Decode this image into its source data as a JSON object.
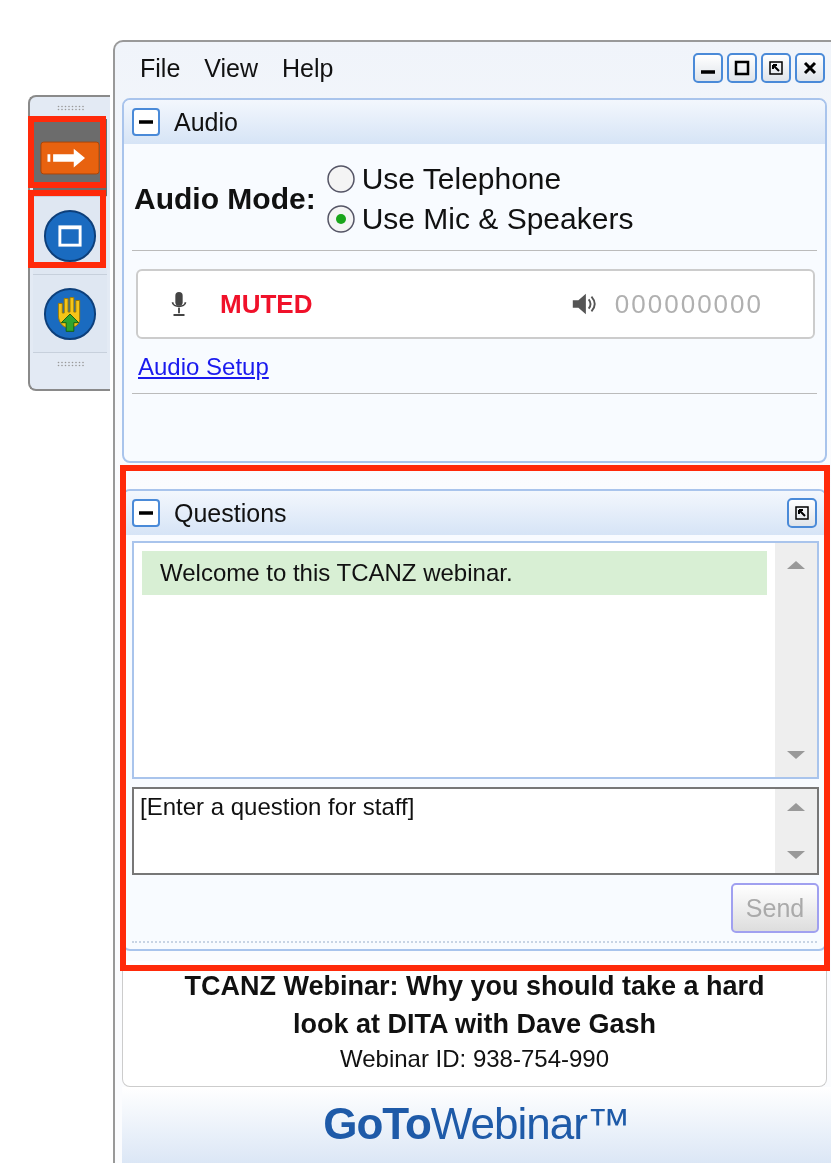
{
  "toolbar": [
    {
      "kind": "arrow",
      "selected": true
    },
    {
      "kind": "screen",
      "selected": false
    },
    {
      "kind": "hand",
      "selected": false
    }
  ],
  "menu": [
    "File",
    "View",
    "Help"
  ],
  "audio_panel": {
    "title": "Audio",
    "mode_label": "Audio Mode:",
    "options": [
      {
        "label": "Use Telephone",
        "selected": false
      },
      {
        "label": "Use Mic & Speakers",
        "selected": true
      }
    ],
    "mic_status": "MUTED",
    "speaker_reading": "000000000",
    "setup_link": "Audio Setup"
  },
  "questions_panel": {
    "title": "Questions",
    "messages": [
      "Welcome to this TCANZ webinar."
    ],
    "input": {
      "placeholder": "[Enter a question for staff]"
    },
    "send_button": {
      "label": "Send",
      "disabled": true
    }
  },
  "webinar": {
    "title": "TCANZ Webinar: Why you should take a hard look at DITA with Dave Gash",
    "id_line": "Webinar ID: 938-754-990"
  },
  "logo": "**GoTo**Webinar™"
}
